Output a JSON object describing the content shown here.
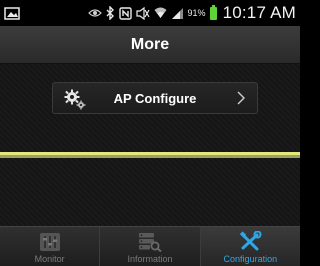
{
  "status_bar": {
    "battery_percent": "91%",
    "time": "10:17 AM",
    "icons": [
      "image-icon",
      "eye-icon",
      "bluetooth-icon",
      "nfc-icon",
      "mute-icon",
      "wifi-icon",
      "signal-icon",
      "battery-icon"
    ],
    "battery_level": 0.91,
    "battery_color": "#5ed43a"
  },
  "header": {
    "title": "More"
  },
  "menu": {
    "items": [
      {
        "label": "AP Configure",
        "icon": "gear-icon"
      }
    ]
  },
  "divider_color": "#e2e87a",
  "tabs": [
    {
      "label": "Monitor",
      "icon": "sliders-icon",
      "active": false
    },
    {
      "label": "Information",
      "icon": "database-search-icon",
      "active": false
    },
    {
      "label": "Configuration",
      "icon": "tools-icon",
      "active": true
    }
  ],
  "accent_color": "#2fa7e6"
}
